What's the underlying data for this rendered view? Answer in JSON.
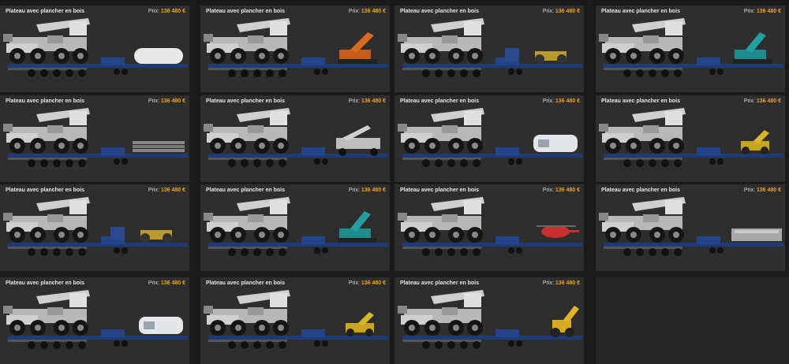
{
  "ui": {
    "price_label": "Prix:",
    "colors": {
      "background": "#1a1a1a",
      "card": "#2e2e2e",
      "title": "#e6e6e6",
      "price": "#f0a020",
      "trailer": "#1e3a78"
    }
  },
  "cards": [
    {
      "title": "Plateau avec plancher en bois",
      "price": "136 480 €",
      "cargo": "tank-icon"
    },
    {
      "title": "Plateau avec plancher en bois",
      "price": "136 480 €",
      "cargo": "excavator-orange-icon"
    },
    {
      "title": "Plateau avec plancher en bois",
      "price": "136 480 €",
      "cargo": "roller-compactor-icon"
    },
    {
      "title": "Plateau avec plancher en bois",
      "price": "136 480 €",
      "cargo": "excavator-teal-icon"
    },
    {
      "title": "Plateau avec plancher en bois",
      "price": "136 480 €",
      "cargo": "pipes-icon"
    },
    {
      "title": "Plateau avec plancher en bois",
      "price": "136 480 €",
      "cargo": "mobile-crane-icon"
    },
    {
      "title": "Plateau avec plancher en bois",
      "price": "136 480 €",
      "cargo": "white-machine-icon"
    },
    {
      "title": "Plateau avec plancher en bois",
      "price": "136 480 €",
      "cargo": "yellow-loader-icon"
    },
    {
      "title": "Plateau avec plancher en bois",
      "price": "136 480 €",
      "cargo": "roller-compactor-icon"
    },
    {
      "title": "Plateau avec plancher en bois",
      "price": "136 480 €",
      "cargo": "excavator-teal-icon"
    },
    {
      "title": "Plateau avec plancher en bois",
      "price": "136 480 €",
      "cargo": "helicopter-icon"
    },
    {
      "title": "Plateau avec plancher en bois",
      "price": "136 480 €",
      "cargo": "grey-machine-icon"
    },
    {
      "title": "Plateau avec plancher en bois",
      "price": "136 480 €",
      "cargo": "white-machine-icon"
    },
    {
      "title": "Plateau avec plancher en bois",
      "price": "136 480 €",
      "cargo": "yellow-loader-icon"
    },
    {
      "title": "Plateau avec plancher en bois",
      "price": "136 480 €",
      "cargo": "backhoe-icon"
    }
  ]
}
